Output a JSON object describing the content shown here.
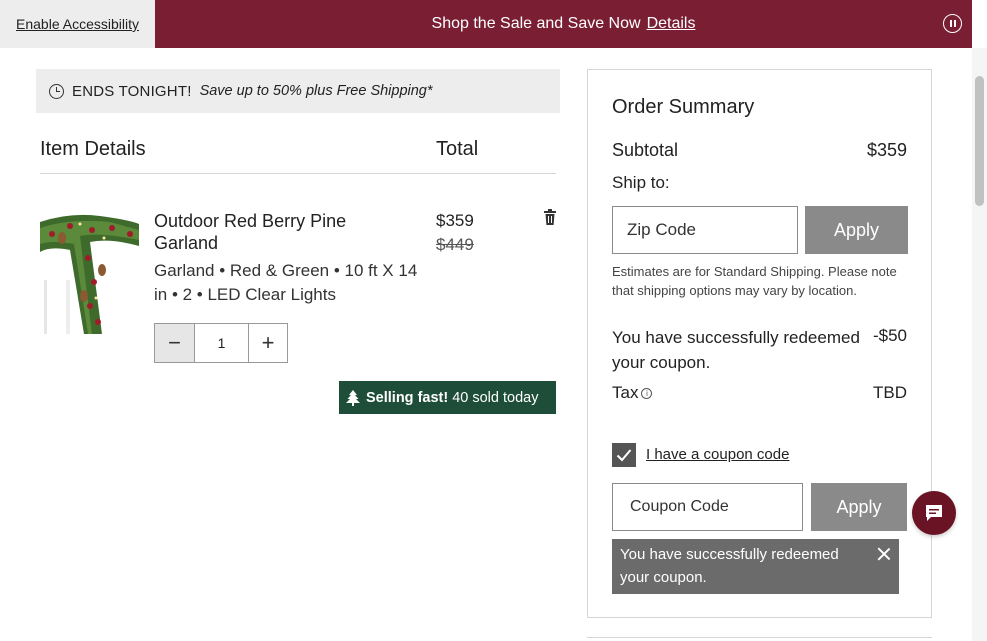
{
  "banner": {
    "accessibility_label": "Enable Accessibility",
    "promo_text": "Shop the Sale and Save Now",
    "details_label": "Details",
    "color": "#7a1f33"
  },
  "ends": {
    "headline": "ENDS TONIGHT!",
    "offer": "Save up to 50% plus Free Shipping*"
  },
  "cart": {
    "col_item": "Item Details",
    "col_total": "Total",
    "item": {
      "name": "Outdoor Red Berry Pine Garland",
      "attributes": "Garland • Red & Green • 10 ft X 14 in • 2 • LED Clear Lights",
      "price": "$359",
      "old_price": "$449",
      "quantity": "1",
      "minus": "−",
      "plus": "+"
    },
    "selling_fast": {
      "bold": "Selling fast!",
      "rest": "40 sold today",
      "color": "#1e4d3a"
    }
  },
  "summary": {
    "title": "Order Summary",
    "subtotal_label": "Subtotal",
    "subtotal_value": "$359",
    "ship_to": "Ship to:",
    "zip_placeholder": "Zip Code",
    "apply_label": "Apply",
    "estimate_note": "Estimates are for Standard Shipping. Please note that shipping options may vary by location.",
    "coupon_line": "You have successfully redeemed your coupon.",
    "coupon_value": "-$50",
    "tax_label": "Tax",
    "tax_value": "TBD",
    "coupon_checkbox_label": "I have a coupon code",
    "coupon_placeholder": "Coupon Code",
    "coupon_apply_label": "Apply",
    "toast": "You have successfully redeemed your coupon."
  }
}
